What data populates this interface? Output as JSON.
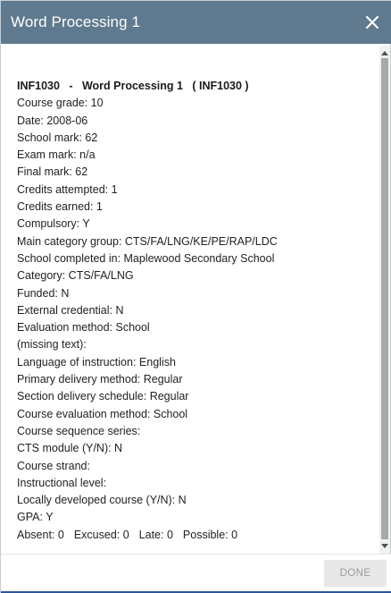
{
  "dialog": {
    "title": "Word Processing 1",
    "done_label": "DONE"
  },
  "course": {
    "heading": "INF1030   -   Word Processing 1   ( INF1030 )",
    "fields": [
      "Course grade: 10",
      "Date: 2008-06",
      "School mark: 62",
      "Exam mark: n/a",
      "Final mark: 62",
      "Credits attempted: 1",
      "Credits earned: 1",
      "Compulsory: Y",
      "Main category group: CTS/FA/LNG/KE/PE/RAP/LDC",
      "School completed in: Maplewood Secondary School",
      "Category: CTS/FA/LNG",
      "Funded: N",
      "External credential: N",
      "Evaluation method: School",
      "(missing text):",
      "Language of instruction: English",
      "Primary delivery method: Regular",
      "Section delivery schedule: Regular",
      "Course evaluation method: School",
      "Course sequence series:",
      "CTS module (Y/N): N",
      "Course strand:",
      "Instructional level:",
      "Locally developed course (Y/N): N",
      "GPA: Y"
    ],
    "attendance": {
      "absent": "Absent: 0",
      "excused": "Excused: 0",
      "late": "Late: 0",
      "possible": "Possible: 0"
    }
  },
  "icons": {
    "close": "close-icon",
    "scroll_up": "scroll-up-arrow-icon",
    "scroll_down": "scroll-down-arrow-icon"
  },
  "colors": {
    "header_bg": "#5f7a8e",
    "done_bg": "#e8e8e8",
    "done_text": "#9a9a9a",
    "bottom_accent": "#2f5597"
  }
}
